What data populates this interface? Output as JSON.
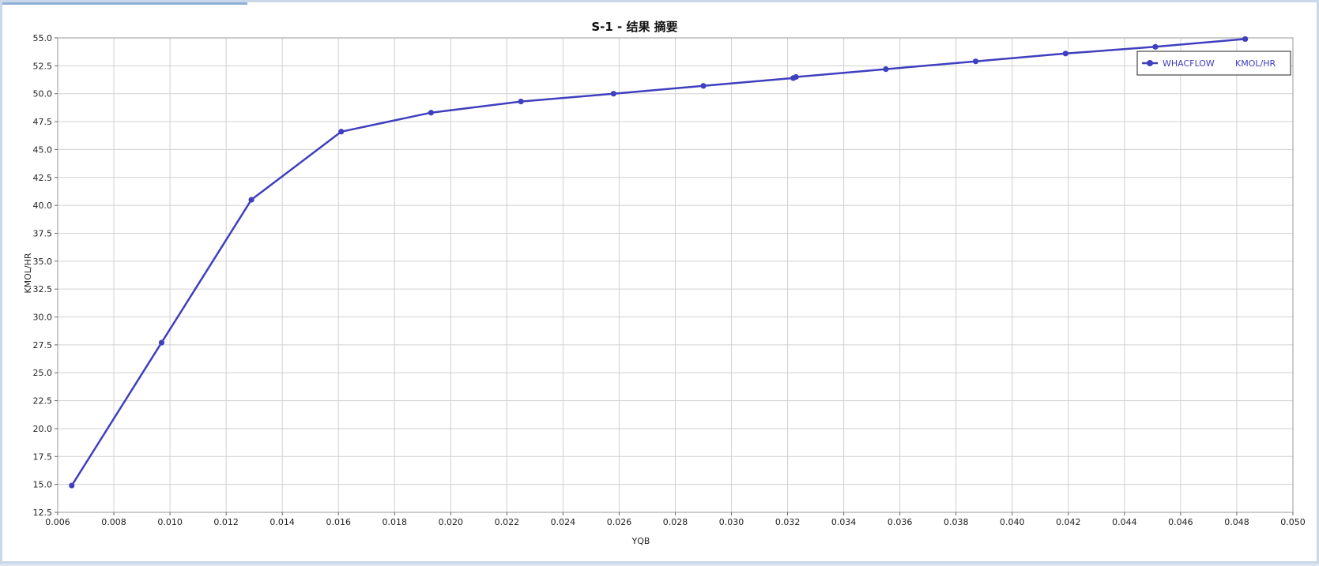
{
  "chart_data": {
    "type": "line",
    "title": "S-1 - 结果 摘要",
    "xlabel": "YQB",
    "ylabel": "KMOL/HR",
    "xlim": [
      0.006,
      0.05
    ],
    "ylim": [
      12.5,
      55.0
    ],
    "x_ticks": [
      "0.006",
      "0.008",
      "0.010",
      "0.012",
      "0.014",
      "0.016",
      "0.018",
      "0.020",
      "0.022",
      "0.024",
      "0.026",
      "0.028",
      "0.030",
      "0.032",
      "0.034",
      "0.036",
      "0.038",
      "0.040",
      "0.042",
      "0.044",
      "0.046",
      "0.048",
      "0.050"
    ],
    "y_ticks": [
      "12.5",
      "15.0",
      "17.5",
      "20.0",
      "22.5",
      "25.0",
      "27.5",
      "30.0",
      "32.5",
      "35.0",
      "37.5",
      "40.0",
      "42.5",
      "45.0",
      "47.5",
      "50.0",
      "52.5",
      "55.0"
    ],
    "grid": true,
    "legend_position": "top-right",
    "color": "#3f3fbf",
    "series": [
      {
        "name": "WHACFLOW",
        "unit": "KMOL/HR",
        "x": [
          0.0065,
          0.0097,
          0.0129,
          0.0161,
          0.0193,
          0.0225,
          0.0258,
          0.029,
          0.0322,
          0.0323,
          0.0355,
          0.0387,
          0.0419,
          0.0451,
          0.0483
        ],
        "y": [
          14.9,
          27.7,
          40.5,
          46.6,
          48.3,
          49.3,
          50.0,
          50.7,
          51.4,
          51.5,
          52.2,
          52.9,
          53.6,
          54.2,
          54.9
        ]
      }
    ]
  }
}
